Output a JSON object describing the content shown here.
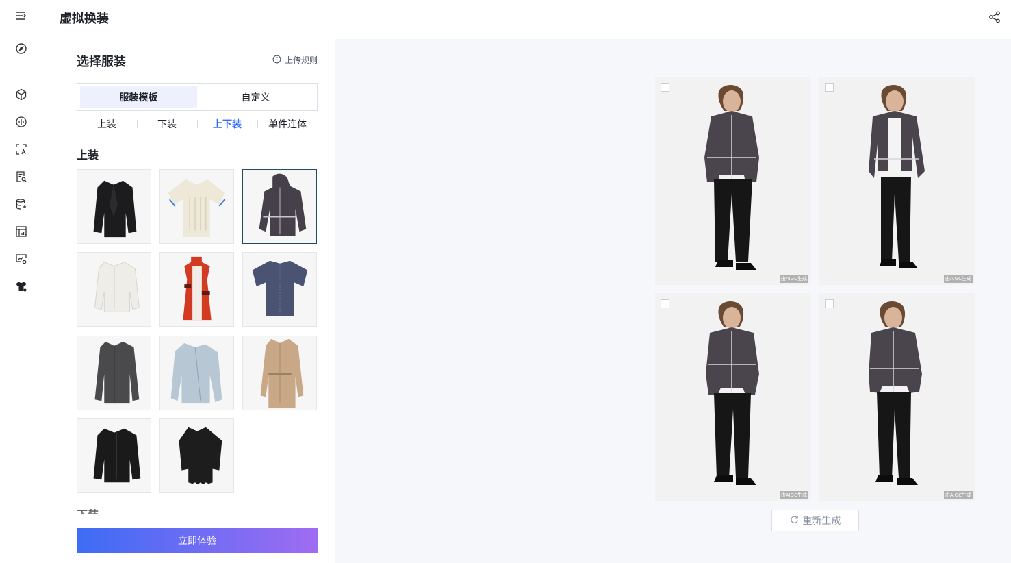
{
  "header": {
    "title": "虚拟换装"
  },
  "nav": {
    "icons": [
      "menu-icon",
      "compass-icon",
      "cube-icon",
      "audio-wave-icon",
      "scan-text-icon",
      "document-search-icon",
      "database-sparkle-icon",
      "layout-chart-icon",
      "monitor-settings-icon",
      "shirt-icon"
    ]
  },
  "panel": {
    "title": "选择服装",
    "rules_label": "上传规则",
    "segments": [
      "服装模板",
      "自定义"
    ],
    "active_segment": "服装模板",
    "subtabs": [
      "上装",
      "下装",
      "上下装",
      "单件连体"
    ],
    "active_subtab": "上下装",
    "section_tops": "上装",
    "section_bottoms": "下装",
    "garments": [
      {
        "name": "black-blazer",
        "color": "#1c1c1e"
      },
      {
        "name": "cream-knit-polo",
        "color": "#eee8d8"
      },
      {
        "name": "grey-hooded-jacket",
        "color": "#45404a",
        "selected": true
      },
      {
        "name": "white-cropped-jacket",
        "color": "#eeede8"
      },
      {
        "name": "red-striped-vest",
        "color": "#d33a22"
      },
      {
        "name": "navy-tshirt",
        "color": "#4a5472"
      },
      {
        "name": "grey-plaid-shirt",
        "color": "#4a4a4c"
      },
      {
        "name": "light-blue-shirt",
        "color": "#b8c7d4"
      },
      {
        "name": "beige-trench-coat",
        "color": "#c8a886"
      },
      {
        "name": "black-leather-jacket",
        "color": "#1a1a1a"
      },
      {
        "name": "black-frayed-shirt",
        "color": "#1d1d1d"
      }
    ],
    "cta_label": "立即体验"
  },
  "results": {
    "watermark": "由AIGC生成",
    "regenerate_label": "重新生成",
    "colors": {
      "jacket": "#4a454d",
      "pants": "#161616",
      "skin": "#d9b49a",
      "hair": "#6b4a33"
    }
  }
}
